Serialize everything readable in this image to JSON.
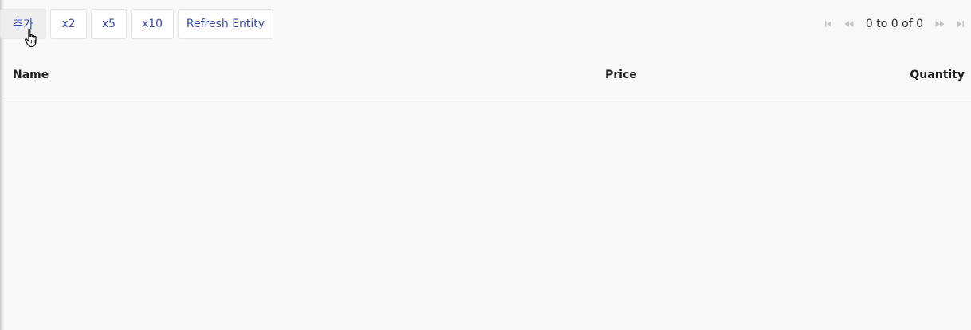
{
  "toolbar": {
    "add_label": "추가",
    "x2_label": "x2",
    "x5_label": "x5",
    "x10_label": "x10",
    "refresh_label": "Refresh Entity"
  },
  "pagination": {
    "summary": "0 to 0 of 0",
    "icons": [
      "first-page-icon",
      "previous-page-icon",
      "next-page-icon",
      "last-page-icon"
    ]
  },
  "grid": {
    "columns": [
      "Name",
      "Price",
      "Quantity"
    ],
    "rows": []
  },
  "colors": {
    "accent": "#3b4ba3",
    "background": "#f8f8f8",
    "disabled_icon": "#c4c4c4"
  }
}
